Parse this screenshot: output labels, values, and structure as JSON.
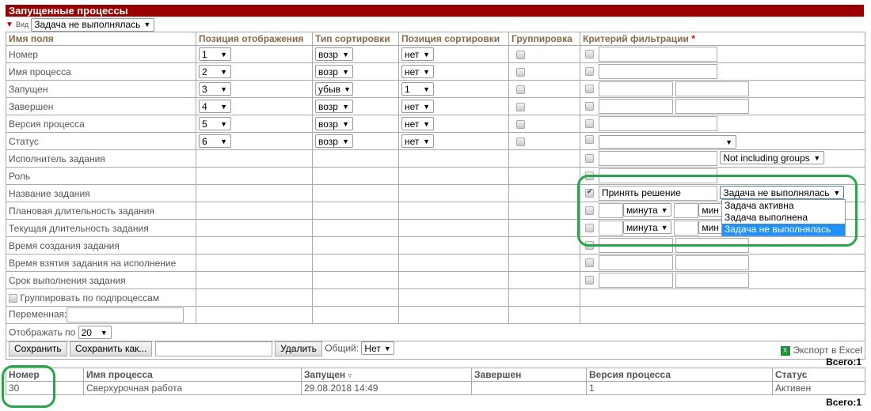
{
  "title": "Запущенные процессы",
  "view": {
    "label": "Вид",
    "value": "Задача не выполнялась"
  },
  "headers": [
    "Имя поля",
    "Позиция отображения",
    "Тип сортировки",
    "Позиция сортировки",
    "Группировка",
    "Критерий фильтрации"
  ],
  "required_mark": "*",
  "rows": [
    {
      "name": "Номер",
      "pos": "1",
      "sort": "возр",
      "sortpos": "нет"
    },
    {
      "name": "Имя процесса",
      "pos": "2",
      "sort": "возр",
      "sortpos": "нет"
    },
    {
      "name": "Запущен",
      "pos": "3",
      "sort": "убыв",
      "sortpos": "1"
    },
    {
      "name": "Завершен",
      "pos": "4",
      "sort": "возр",
      "sortpos": "нет"
    },
    {
      "name": "Версия процесса",
      "pos": "5",
      "sort": "возр",
      "sortpos": "нет"
    },
    {
      "name": "Статус",
      "pos": "6",
      "sort": "возр",
      "sortpos": "нет"
    },
    {
      "name": "Исполнитель задания"
    },
    {
      "name": "Роль"
    },
    {
      "name": "Название задания"
    },
    {
      "name": "Плановая длительность задания"
    },
    {
      "name": "Текущая длительность задания"
    },
    {
      "name": "Время создания задания"
    },
    {
      "name": "Время взятия задания на исполнение"
    },
    {
      "name": "Срок выполнения задания"
    }
  ],
  "filters": {
    "executor_groups": "Not including groups",
    "task_name_value": "Принять решение",
    "task_state": "Задача не выполнялась",
    "task_state_options": [
      "Задача активна",
      "Задача выполнена",
      "Задача не выполнялась"
    ],
    "unit": "минута",
    "unit_cut": "мин"
  },
  "group_sub": "Группировать по подпроцессам",
  "variable_label": "Переменная:",
  "page_size_label": "Отображать по",
  "page_size": "20",
  "buttons": {
    "save": "Сохранить",
    "save_as": "Сохранить как...",
    "delete": "Удалить"
  },
  "shared_label": "Общий:",
  "shared_value": "Нет",
  "export": "Экспорт в Excel",
  "total": "Всего:1",
  "results": {
    "headers": [
      "Номер",
      "Имя процесса",
      "Запущен",
      "Завершен",
      "Версия процесса",
      "Статус"
    ],
    "sort_mark": "▿",
    "rows": [
      [
        "30",
        "Сверхурочная работа",
        "29.08.2018 14:49",
        "",
        "1",
        "Активен"
      ]
    ]
  }
}
